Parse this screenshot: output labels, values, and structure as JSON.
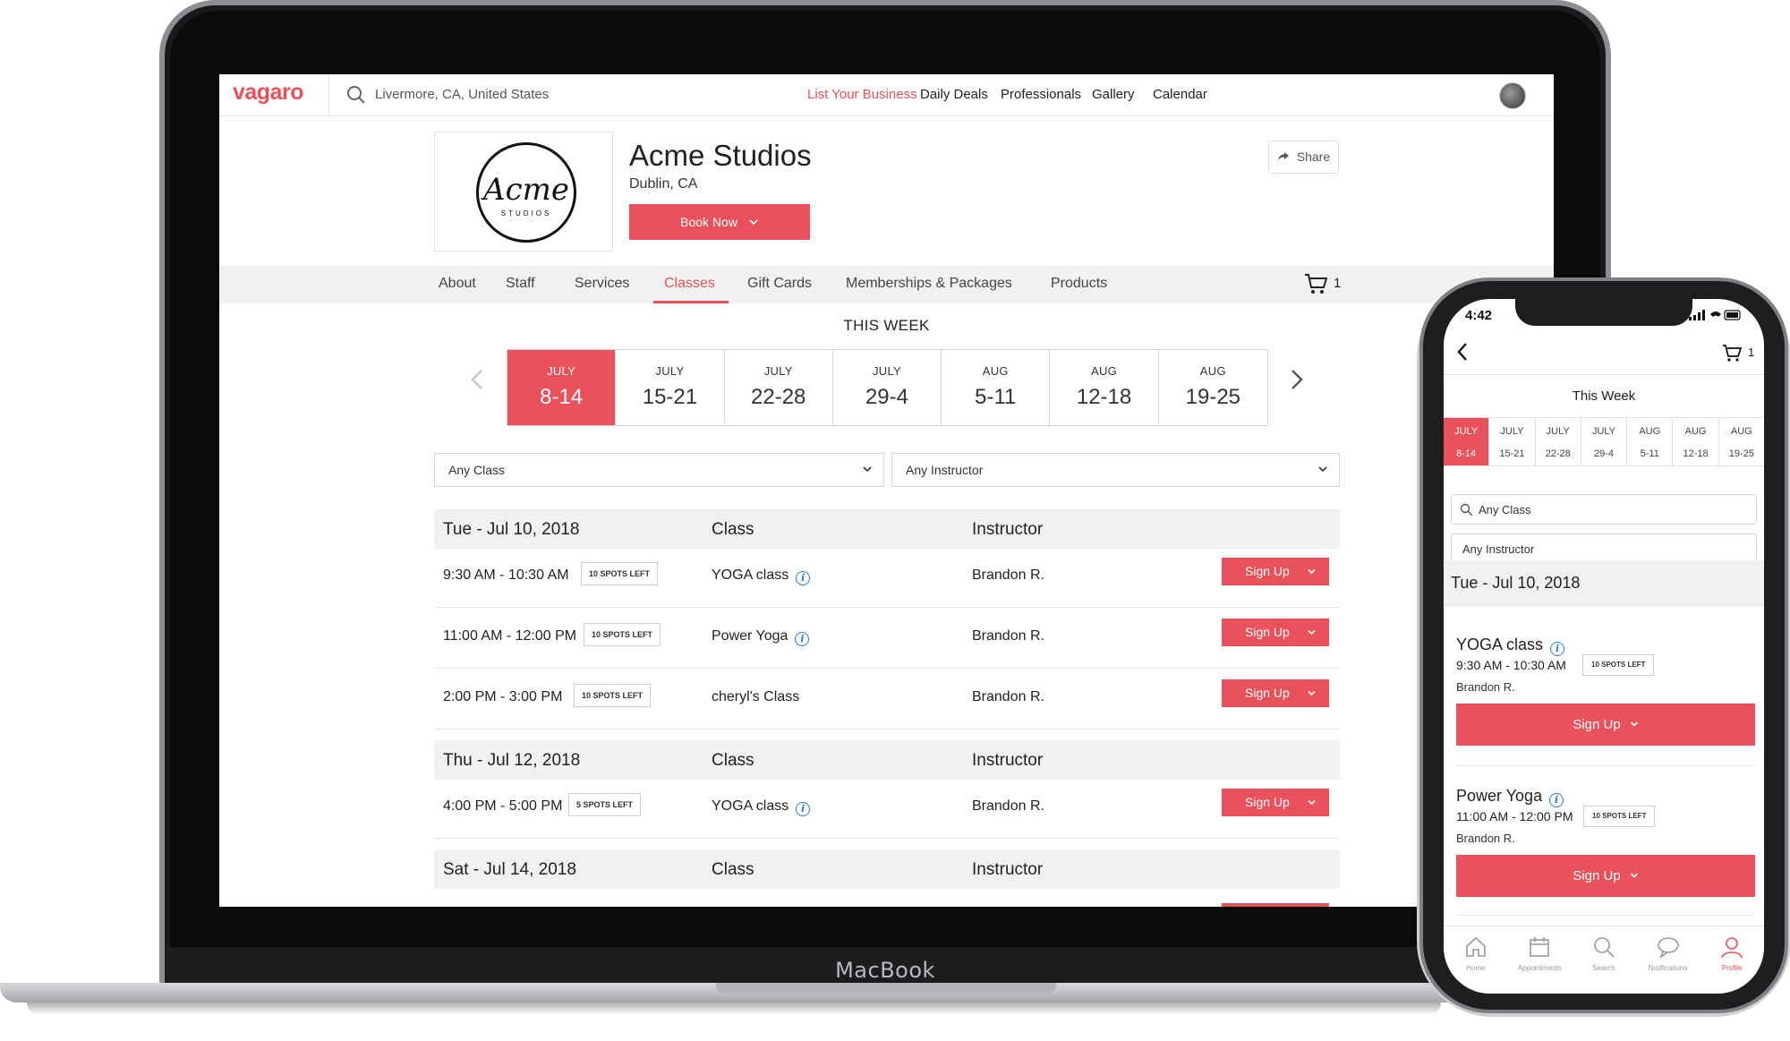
{
  "laptop": {
    "brand": "MacBook"
  },
  "site": {
    "logo": "vagaro",
    "search_value": "Livermore, CA, United States",
    "nav": [
      "List Your Business",
      "Daily Deals",
      "Professionals",
      "Gallery",
      "Calendar"
    ],
    "accent_color": "#e9525a"
  },
  "business": {
    "logo_text": "Acme",
    "logo_subtext": "STUDIOS",
    "name": "Acme Studios",
    "location": "Dublin, CA",
    "book_label": "Book Now",
    "share_label": "Share"
  },
  "tabs": [
    "About",
    "Staff",
    "Services",
    "Classes",
    "Gift Cards",
    "Memberships & Packages",
    "Products"
  ],
  "active_tab": "Classes",
  "cart_count": "1",
  "week_title": "THIS WEEK",
  "weeks": [
    {
      "month": "JULY",
      "range": "8-14"
    },
    {
      "month": "JULY",
      "range": "15-21"
    },
    {
      "month": "JULY",
      "range": "22-28"
    },
    {
      "month": "JULY",
      "range": "29-4"
    },
    {
      "month": "AUG",
      "range": "5-11"
    },
    {
      "month": "AUG",
      "range": "12-18"
    },
    {
      "month": "AUG",
      "range": "19-25"
    }
  ],
  "filters": {
    "class": "Any Class",
    "instructor": "Any Instructor"
  },
  "columns": {
    "class": "Class",
    "instructor": "Instructor"
  },
  "days": [
    {
      "date": "Tue - Jul 10, 2018",
      "classes": [
        {
          "time": "9:30 AM - 10:30 AM",
          "spots": "10 SPOTS LEFT",
          "name": "YOGA class",
          "info": true,
          "instructor": "Brandon R.",
          "action": "Sign Up"
        },
        {
          "time": "11:00 AM - 12:00 PM",
          "spots": "10 SPOTS LEFT",
          "name": "Power Yoga",
          "info": true,
          "instructor": "Brandon R.",
          "action": "Sign Up"
        },
        {
          "time": "2:00 PM - 3:00 PM",
          "spots": "10 SPOTS LEFT",
          "name": "cheryl's Class",
          "info": false,
          "instructor": "Brandon R.",
          "action": "Sign Up"
        }
      ]
    },
    {
      "date": "Thu - Jul 12, 2018",
      "classes": [
        {
          "time": "4:00 PM - 5:00 PM",
          "spots": "5 SPOTS LEFT",
          "name": "YOGA class",
          "info": true,
          "instructor": "Brandon R.",
          "action": "Sign Up"
        }
      ]
    },
    {
      "date": "Sat - Jul 14, 2018",
      "classes": []
    }
  ],
  "phone": {
    "time": "4:42",
    "cart_count": "1",
    "week_title": "This Week",
    "weeks": [
      {
        "month": "JULY",
        "range": "8-14"
      },
      {
        "month": "JULY",
        "range": "15-21"
      },
      {
        "month": "JULY",
        "range": "22-28"
      },
      {
        "month": "JULY",
        "range": "29-4"
      },
      {
        "month": "AUG",
        "range": "5-11"
      },
      {
        "month": "AUG",
        "range": "12-18"
      },
      {
        "month": "AUG",
        "range": "19-25"
      }
    ],
    "class_filter": "Any Class",
    "instructor_filter": "Any Instructor",
    "day": "Tue - Jul 10, 2018",
    "items": [
      {
        "name": "YOGA class",
        "time": "9:30 AM - 10:30 AM",
        "spots": "10 SPOTS LEFT",
        "instructor": "Brandon R.",
        "action": "Sign Up"
      },
      {
        "name": "Power Yoga",
        "time": "11:00 AM - 12:00 PM",
        "spots": "10 SPOTS LEFT",
        "instructor": "Brandon R.",
        "action": "Sign Up"
      }
    ],
    "tabbar": [
      "Home",
      "Appointments",
      "Search",
      "Notifications",
      "Profile"
    ],
    "active_tab": "Profile"
  }
}
